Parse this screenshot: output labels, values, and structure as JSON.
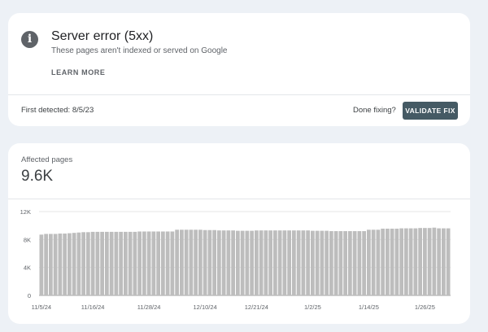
{
  "issue": {
    "icon": "info-icon",
    "title": "Server error (5xx)",
    "subtitle": "These pages aren't indexed or served on Google",
    "learn_more": "LEARN MORE",
    "first_detected": "First detected: 8/5/23",
    "done_fixing": "Done fixing?",
    "validate_fix": "VALIDATE FIX"
  },
  "summary": {
    "label": "Affected pages",
    "value": "9.6K"
  },
  "chart_data": {
    "type": "bar",
    "title": "",
    "xlabel": "",
    "ylabel": "",
    "ylim": [
      0,
      12000
    ],
    "y_ticks": [
      "0",
      "4K",
      "8K",
      "12K"
    ],
    "x_tick_labels": [
      "11/5/24",
      "11/16/24",
      "11/28/24",
      "12/10/24",
      "12/21/24",
      "1/2/25",
      "1/14/25",
      "1/26/25"
    ],
    "categories": [
      "11/5/24",
      "11/6/24",
      "11/7/24",
      "11/8/24",
      "11/9/24",
      "11/10/24",
      "11/11/24",
      "11/12/24",
      "11/13/24",
      "11/14/24",
      "11/15/24",
      "11/16/24",
      "11/17/24",
      "11/18/24",
      "11/19/24",
      "11/20/24",
      "11/21/24",
      "11/22/24",
      "11/23/24",
      "11/24/24",
      "11/25/24",
      "11/26/24",
      "11/27/24",
      "11/28/24",
      "11/29/24",
      "11/30/24",
      "12/1/24",
      "12/2/24",
      "12/3/24",
      "12/4/24",
      "12/5/24",
      "12/6/24",
      "12/7/24",
      "12/8/24",
      "12/9/24",
      "12/10/24",
      "12/11/24",
      "12/12/24",
      "12/13/24",
      "12/14/24",
      "12/15/24",
      "12/16/24",
      "12/17/24",
      "12/18/24",
      "12/19/24",
      "12/20/24",
      "12/21/24",
      "12/22/24",
      "12/23/24",
      "12/24/24",
      "12/25/24",
      "12/26/24",
      "12/27/24",
      "12/28/24",
      "12/29/24",
      "12/30/24",
      "12/31/24",
      "1/1/25",
      "1/2/25",
      "1/3/25",
      "1/4/25",
      "1/5/25",
      "1/6/25",
      "1/7/25",
      "1/8/25",
      "1/9/25",
      "1/10/25",
      "1/11/25",
      "1/12/25",
      "1/13/25",
      "1/14/25",
      "1/15/25",
      "1/16/25",
      "1/17/25",
      "1/18/25",
      "1/19/25",
      "1/20/25",
      "1/21/25",
      "1/22/25",
      "1/23/25",
      "1/24/25",
      "1/25/25",
      "1/26/25",
      "1/27/25",
      "1/28/25",
      "1/29/25",
      "1/30/25",
      "1/31/25"
    ],
    "values": [
      8700,
      8800,
      8800,
      8800,
      8850,
      8850,
      8900,
      8950,
      9000,
      9050,
      9050,
      9100,
      9100,
      9100,
      9100,
      9100,
      9100,
      9100,
      9100,
      9100,
      9100,
      9150,
      9150,
      9150,
      9150,
      9150,
      9150,
      9150,
      9150,
      9400,
      9400,
      9400,
      9400,
      9400,
      9400,
      9350,
      9350,
      9350,
      9300,
      9300,
      9300,
      9300,
      9250,
      9250,
      9250,
      9250,
      9300,
      9300,
      9300,
      9300,
      9300,
      9300,
      9300,
      9300,
      9300,
      9300,
      9300,
      9300,
      9250,
      9250,
      9250,
      9250,
      9200,
      9200,
      9200,
      9200,
      9200,
      9200,
      9200,
      9200,
      9400,
      9400,
      9400,
      9550,
      9550,
      9550,
      9550,
      9600,
      9600,
      9600,
      9600,
      9650,
      9650,
      9650,
      9700,
      9600,
      9600,
      9600
    ],
    "colors": {
      "bar": "#bdbdbd",
      "grid": "#e6e6e6",
      "axis": "#9e9e9e",
      "tick_text": "#5f6368"
    }
  }
}
